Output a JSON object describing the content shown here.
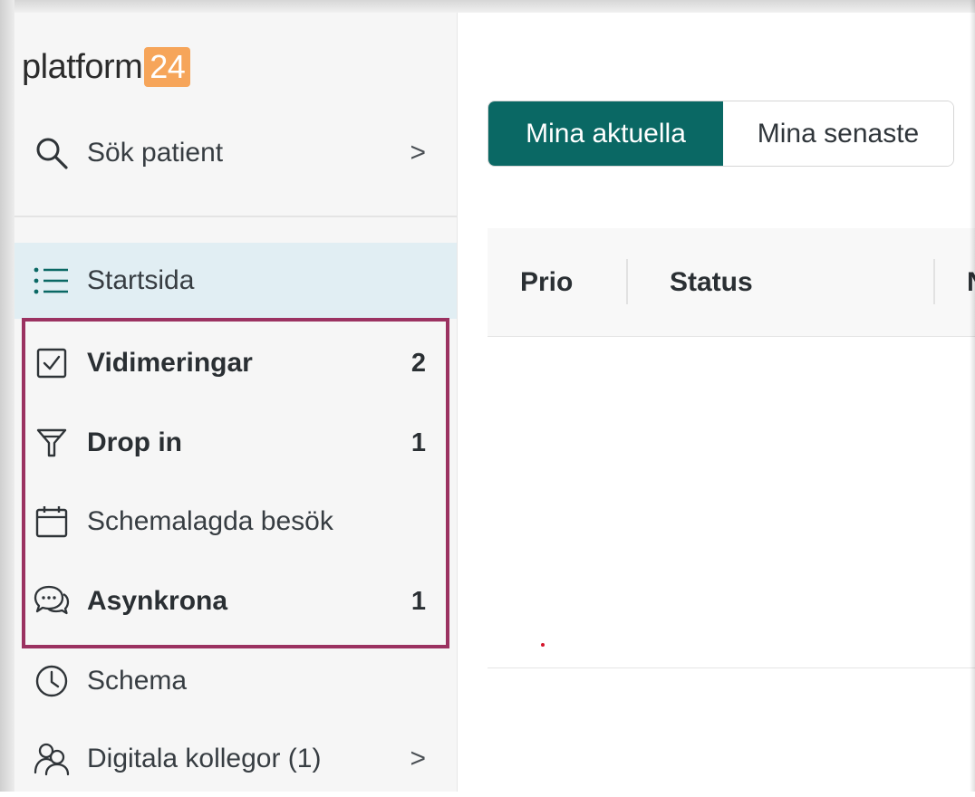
{
  "logo": {
    "text": "platform",
    "badge": "24"
  },
  "search": {
    "label": "Sök patient",
    "chevron": ">"
  },
  "nav": {
    "items": [
      {
        "label": "Startsida",
        "count": "",
        "bold": false
      },
      {
        "label": "Vidimeringar",
        "count": "2",
        "bold": true
      },
      {
        "label": "Drop in",
        "count": "1",
        "bold": true
      },
      {
        "label": "Schemalagda besök",
        "count": "",
        "bold": false
      },
      {
        "label": "Asynkrona",
        "count": "1",
        "bold": true
      },
      {
        "label": "Schema",
        "count": "",
        "bold": false
      },
      {
        "label": "Digitala kollegor (1)",
        "count": "",
        "bold": false,
        "chevron": ">"
      }
    ]
  },
  "tabs": [
    {
      "label": "Mina aktuella",
      "active": true
    },
    {
      "label": "Mina senaste",
      "active": false
    }
  ],
  "table": {
    "columns": [
      "Prio",
      "Status",
      "N"
    ]
  },
  "colors": {
    "accent": "#0a6864",
    "highlight_border": "#9b3261",
    "logo_badge": "#f6a55a",
    "active_nav_bg": "#e1eef3"
  },
  "icons": {
    "search": "search-icon",
    "startsida": "list-icon",
    "vidimeringar": "checkbox-icon",
    "dropin": "funnel-icon",
    "schemalagda": "calendar-icon",
    "asynkrona": "chat-bubbles-icon",
    "schema": "clock-icon",
    "kollegor": "users-icon"
  }
}
